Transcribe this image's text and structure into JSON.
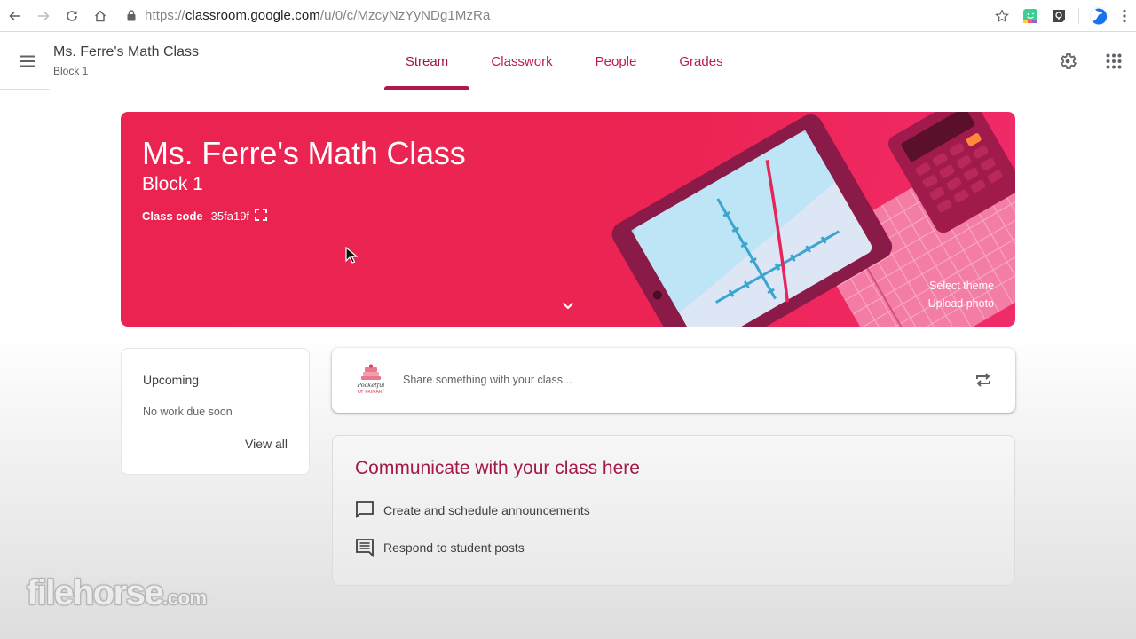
{
  "browser": {
    "url_scheme": "https://",
    "url_host": "classroom.google.com",
    "url_path": "/u/0/c/MzcyNzYyNDg1MzRa",
    "icons": [
      "back-icon",
      "forward-icon",
      "reload-icon",
      "home-icon",
      "lock-icon",
      "star-icon",
      "extension-bitmoji-icon",
      "extension-keep-icon",
      "profile-icon",
      "more-icon"
    ]
  },
  "header": {
    "class_name": "Ms. Ferre's Math Class",
    "section": "Block 1",
    "tabs": [
      {
        "label": "Stream",
        "active": true
      },
      {
        "label": "Classwork",
        "active": false
      },
      {
        "label": "People",
        "active": false
      },
      {
        "label": "Grades",
        "active": false
      }
    ]
  },
  "banner": {
    "title": "Ms. Ferre's Math Class",
    "section": "Block 1",
    "class_code_label": "Class code",
    "class_code": "35fa19f",
    "select_theme": "Select theme",
    "upload_photo": "Upload photo",
    "theme_color": "#ec2453"
  },
  "upcoming": {
    "title": "Upcoming",
    "empty_text": "No work due soon",
    "view_all": "View all"
  },
  "share": {
    "placeholder": "Share something with your class..."
  },
  "communicate": {
    "title": "Communicate with your class here",
    "items": [
      {
        "icon": "announcement-icon",
        "label": "Create and schedule announcements"
      },
      {
        "icon": "comment-icon",
        "label": "Respond to student posts"
      }
    ]
  },
  "watermark": {
    "main": "filehorse",
    "suffix": ".com"
  },
  "colors": {
    "accent": "#b0174f",
    "tab_text": "#c2185b",
    "heading": "#a21848"
  }
}
